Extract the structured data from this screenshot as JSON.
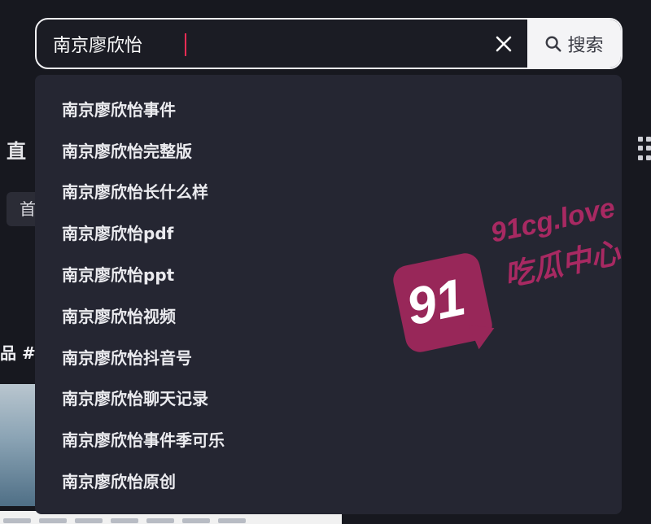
{
  "search": {
    "value": "南京廖欣怡",
    "button_label": "搜索"
  },
  "suggestions": [
    "南京廖欣怡事件",
    "南京廖欣怡完整版",
    "南京廖欣怡长什么样",
    "南京廖欣怡pdf",
    "南京廖欣怡ppt",
    "南京廖欣怡视频",
    "南京廖欣怡抖音号",
    "南京廖欣怡聊天记录",
    "南京廖欣怡事件季可乐",
    "南京廖欣怡原创"
  ],
  "background": {
    "tab_fragment": "直",
    "chip_fragment": "首",
    "hashtag_fragment": "品 #网"
  },
  "watermark": {
    "number": "91",
    "url": "91cg.love",
    "text": "吃瓜中心"
  },
  "colors": {
    "caret": "#fe2c55",
    "dropdown_bg": "#252632",
    "watermark": "#a8285f"
  }
}
